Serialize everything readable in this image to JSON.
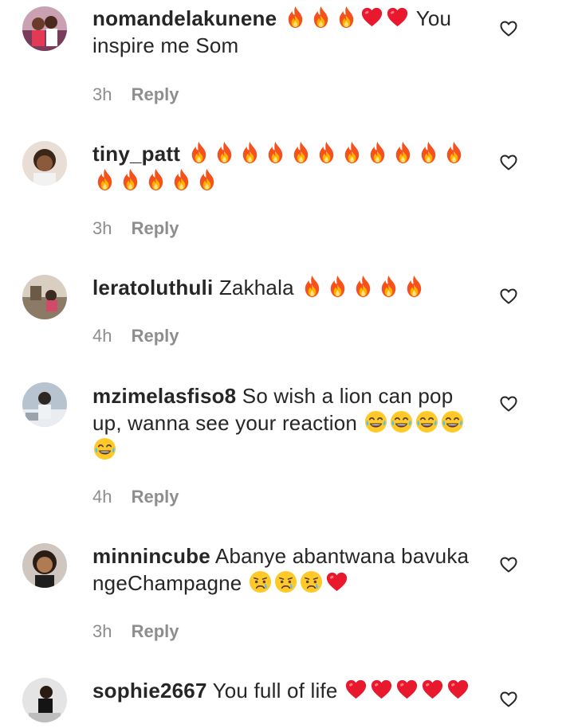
{
  "comments": [
    {
      "username": "nomandelakunene",
      "text_before": "",
      "emojis": [
        "fire",
        "fire",
        "fire",
        "heart",
        "heart"
      ],
      "text_after": "You inspire me Som",
      "time": "3h",
      "reply": "Reply"
    },
    {
      "username": "tiny_patt",
      "text_before": "",
      "emojis": [
        "fire",
        "fire",
        "fire",
        "fire",
        "fire",
        "fire",
        "fire",
        "fire",
        "fire",
        "fire",
        "fire",
        "fire",
        "fire",
        "fire",
        "fire",
        "fire"
      ],
      "text_after": "",
      "time": "3h",
      "reply": "Reply"
    },
    {
      "username": "leratoluthuli",
      "text_before": "Zakhala",
      "emojis": [
        "fire",
        "fire",
        "fire",
        "fire",
        "fire"
      ],
      "text_after": "",
      "time": "4h",
      "reply": "Reply"
    },
    {
      "username": "mzimelasfiso8",
      "text_before": "So wish a lion can pop up, wanna see your reaction",
      "emojis": [
        "laugh",
        "laugh",
        "laugh",
        "laugh",
        "laugh"
      ],
      "text_after": "",
      "time": "4h",
      "reply": "Reply"
    },
    {
      "username": "minnincube",
      "text_before": "Abanye abantwana bavuka ngeChampagne",
      "emojis": [
        "cry",
        "cry",
        "cry",
        "heart"
      ],
      "text_after": "",
      "time": "3h",
      "reply": "Reply"
    },
    {
      "username": "sophie2667",
      "text_before": "You full of life",
      "emojis": [
        "heart",
        "heart",
        "heart",
        "heart",
        "heart"
      ],
      "text_after": "",
      "time": "",
      "reply": ""
    }
  ],
  "colors": {
    "meta": "#8e8e8e",
    "text": "#262626",
    "heart": "#e8192c",
    "fire": "#f4511e"
  }
}
